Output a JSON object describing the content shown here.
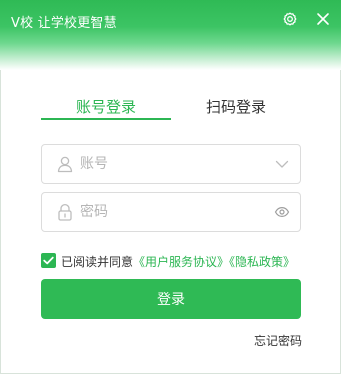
{
  "window": {
    "title": "V校 让学校更智慧"
  },
  "titlebar": {
    "settings_icon": "gear-icon",
    "close_icon": "close-icon"
  },
  "tabs": [
    {
      "label": "账号登录",
      "active": true
    },
    {
      "label": "扫码登录",
      "active": false
    }
  ],
  "account_field": {
    "placeholder": "账号",
    "value": "",
    "lead_icon": "user-icon",
    "trail_icon": "chevron-down-icon"
  },
  "password_field": {
    "placeholder": "密码",
    "value": "",
    "lead_icon": "lock-icon",
    "trail_icon": "eye-icon"
  },
  "agreement": {
    "checked": true,
    "prefix": "已阅读并同意",
    "terms_link": "《用户服务协议》",
    "privacy_link": "《隐私政策》"
  },
  "login_button": {
    "label": "登录"
  },
  "forgot_password": {
    "label": "忘记密码"
  },
  "colors": {
    "accent": "#2cb653",
    "button": "#2fba55",
    "text": "#333333",
    "placeholder": "#b5b5b5"
  }
}
